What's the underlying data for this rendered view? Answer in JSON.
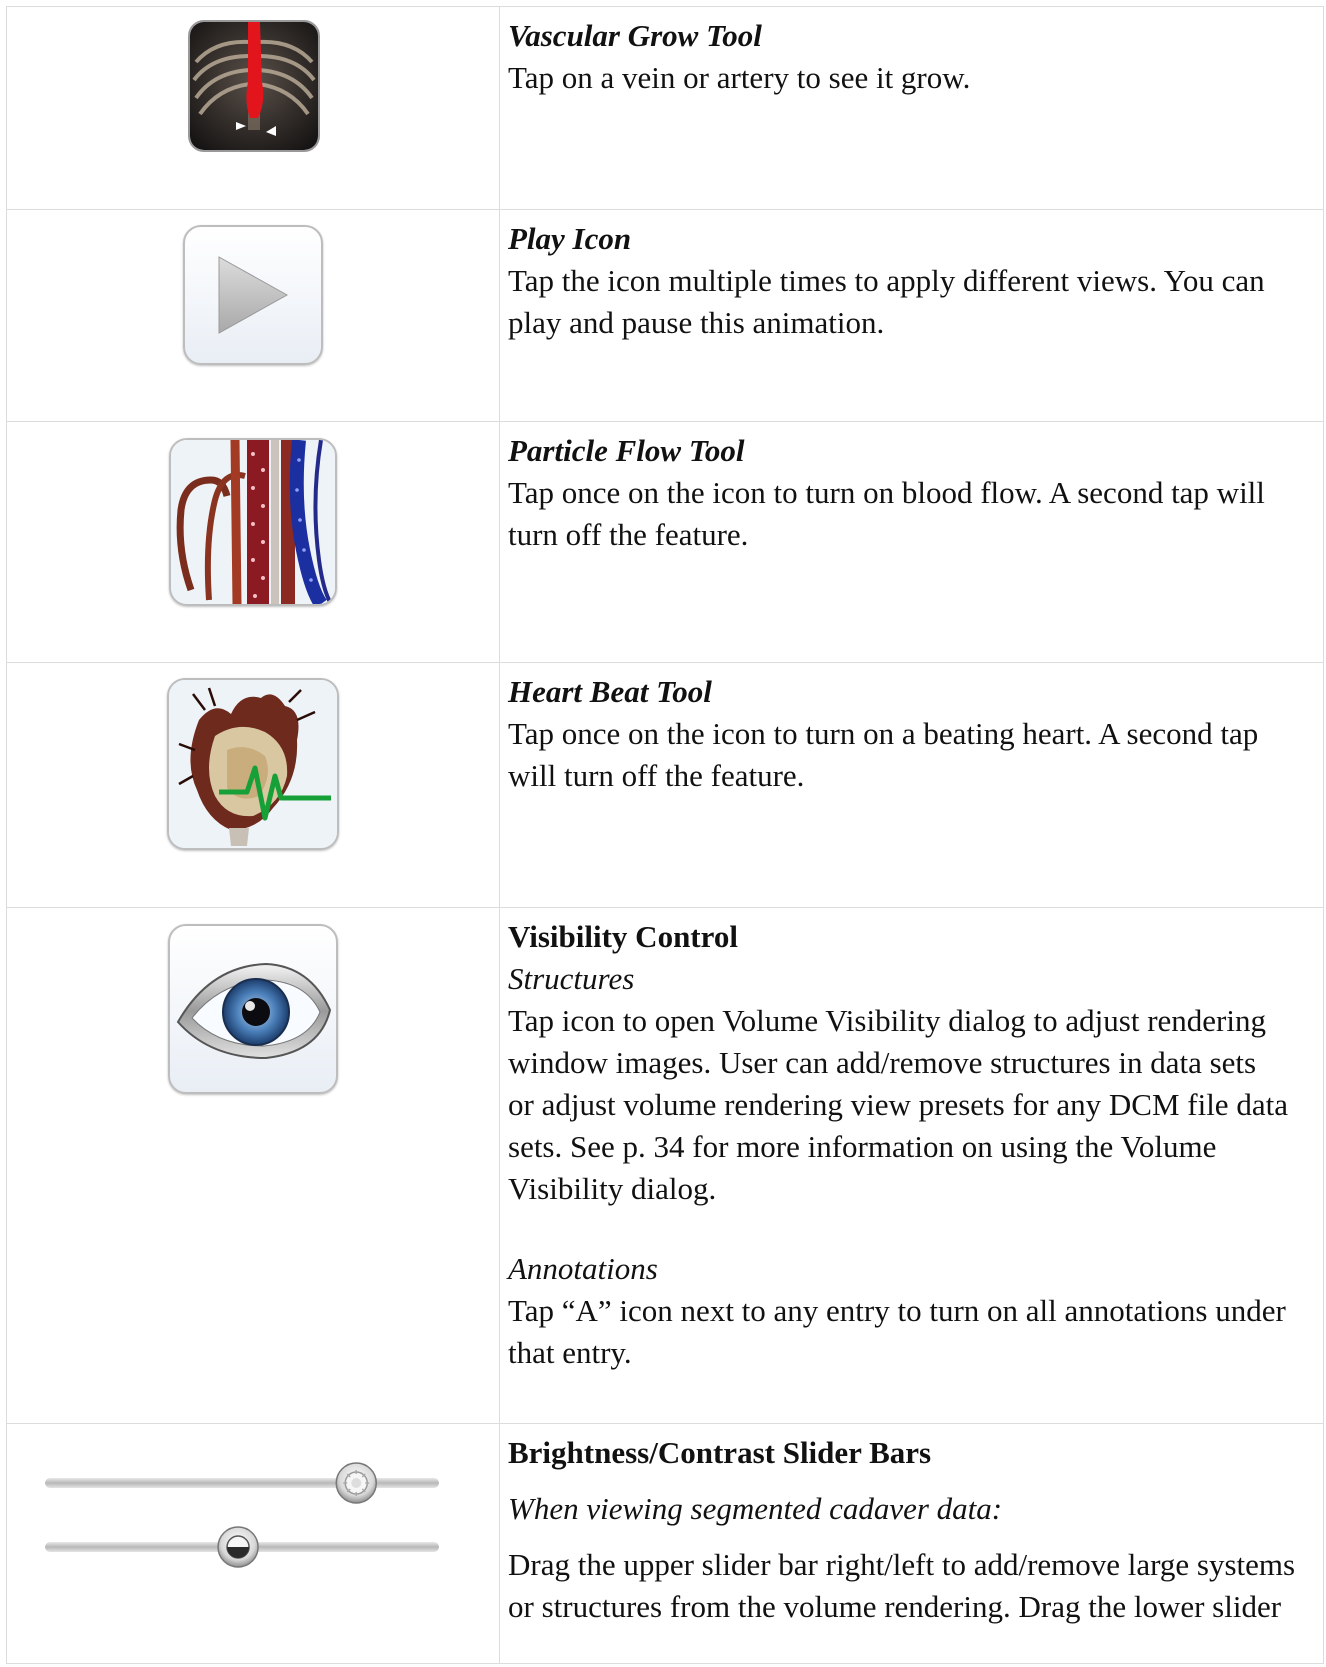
{
  "rows": [
    {
      "icon": "vascular-grow-icon",
      "title": "Vascular Grow Tool",
      "lines": [
        "Tap on a vein or artery to see it grow."
      ]
    },
    {
      "icon": "play-icon",
      "title": "Play Icon",
      "lines": [
        "Tap the icon multiple times to apply different views. You can",
        "play and pause this animation."
      ]
    },
    {
      "icon": "particle-flow-icon",
      "title": "Particle Flow Tool",
      "lines": [
        "Tap once on the icon to turn on blood flow. A second tap will",
        "turn off the feature."
      ]
    },
    {
      "icon": "heart-beat-icon",
      "title": "Heart Beat Tool",
      "lines": [
        "Tap once on the icon to turn on a beating heart. A second tap",
        "will turn off the feature."
      ]
    },
    {
      "icon": "eye-icon",
      "title": "Visibility Control",
      "sub1": "Structures",
      "lines1": [
        "Tap icon to open Volume Visibility dialog to adjust rendering",
        "window images.  User can add/remove structures in data sets",
        "or adjust volume rendering view presets for any DCM file data",
        "sets.  See p. 34 for more information on using the Volume",
        "Visibility dialog."
      ],
      "sub2": "Annotations",
      "lines2": [
        "Tap “A” icon next to any entry to turn on all annotations under",
        "that entry."
      ]
    },
    {
      "icon": "slider-bars-icon",
      "title": "Brightness/Contrast Slider Bars",
      "sub1": "When viewing segmented cadaver data:",
      "lines1": [
        "Drag the upper slider bar right/left to add/remove large systems",
        "or structures from the volume rendering.  Drag the lower slider"
      ],
      "sliders": {
        "upper": 0.79,
        "lower": 0.49
      }
    }
  ]
}
